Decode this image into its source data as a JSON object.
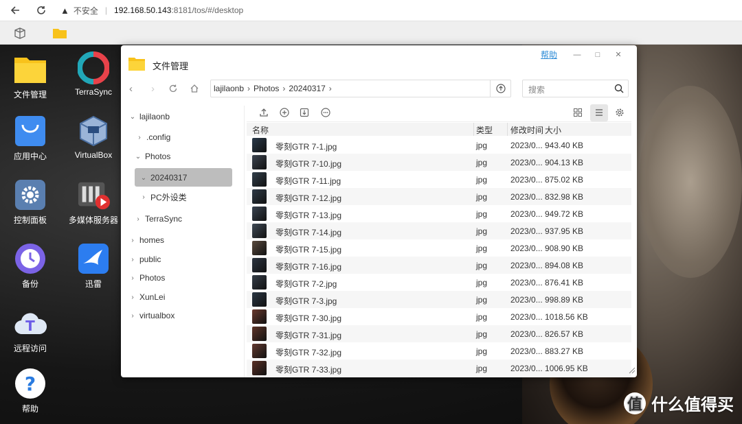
{
  "browser": {
    "insecure_label": "不安全",
    "url_host": "192.168.50.143",
    "url_rest": ":8181/tos/#/desktop"
  },
  "desktop_icons": [
    {
      "label": "文件管理",
      "icon": "folder-icon"
    },
    {
      "label": "TerraSync",
      "icon": "terrasync-icon"
    },
    {
      "label": "应用中心",
      "icon": "app-store-icon"
    },
    {
      "label": "VirtualBox",
      "icon": "virtualbox-icon"
    },
    {
      "label": "控制面板",
      "icon": "gear-icon"
    },
    {
      "label": "多媒体服务器",
      "icon": "media-server-icon"
    },
    {
      "label": "备份",
      "icon": "backup-clock-icon"
    },
    {
      "label": "迅雷",
      "icon": "xunlei-bird-icon"
    },
    {
      "label": "远程访问",
      "icon": "cloud-t-icon"
    },
    {
      "label": "帮助",
      "icon": "help-icon"
    }
  ],
  "watermark": {
    "text": "什么值得买",
    "logo": "值"
  },
  "file_manager": {
    "title": "文件管理",
    "help_label": "帮助",
    "breadcrumb": [
      "lajilaonb",
      "Photos",
      "20240317"
    ],
    "search_placeholder": "搜索",
    "sidebar": {
      "root": "lajilaonb",
      "config": ".config",
      "photos": "Photos",
      "selected": "20240317",
      "pc": "PC外设类",
      "terrasync": "TerraSync",
      "homes": "homes",
      "public": "public",
      "photos_root": "Photos",
      "xunlei": "XunLei",
      "virtualbox": "virtualbox"
    },
    "columns": {
      "name": "名称",
      "type": "类型",
      "modified": "修改时间",
      "size": "大小"
    },
    "files": [
      {
        "name": "零刻GTR 7-1.jpg",
        "type": "jpg",
        "modified": "2023/0...",
        "size": "943.40 KB",
        "thumb": "#2a3a4a"
      },
      {
        "name": "零刻GTR 7-10.jpg",
        "type": "jpg",
        "modified": "2023/0...",
        "size": "904.13 KB",
        "thumb": "#3c4450"
      },
      {
        "name": "零刻GTR 7-11.jpg",
        "type": "jpg",
        "modified": "2023/0...",
        "size": "875.02 KB",
        "thumb": "#33404c"
      },
      {
        "name": "零刻GTR 7-12.jpg",
        "type": "jpg",
        "modified": "2023/0...",
        "size": "832.98 KB",
        "thumb": "#2e3a46"
      },
      {
        "name": "零刻GTR 7-13.jpg",
        "type": "jpg",
        "modified": "2023/0...",
        "size": "949.72 KB",
        "thumb": "#394350"
      },
      {
        "name": "零刻GTR 7-14.jpg",
        "type": "jpg",
        "modified": "2023/0...",
        "size": "937.95 KB",
        "thumb": "#404a56"
      },
      {
        "name": "零刻GTR 7-15.jpg",
        "type": "jpg",
        "modified": "2023/0...",
        "size": "908.90 KB",
        "thumb": "#5a4a3e"
      },
      {
        "name": "零刻GTR 7-16.jpg",
        "type": "jpg",
        "modified": "2023/0...",
        "size": "894.08 KB",
        "thumb": "#2c3440"
      },
      {
        "name": "零刻GTR 7-2.jpg",
        "type": "jpg",
        "modified": "2023/0...",
        "size": "876.41 KB",
        "thumb": "#353d48"
      },
      {
        "name": "零刻GTR 7-3.jpg",
        "type": "jpg",
        "modified": "2023/0...",
        "size": "998.89 KB",
        "thumb": "#2b3744"
      },
      {
        "name": "零刻GTR 7-30.jpg",
        "type": "jpg",
        "modified": "2023/0...",
        "size": "1018.56 KB",
        "thumb": "#6a3a2e"
      },
      {
        "name": "零刻GTR 7-31.jpg",
        "type": "jpg",
        "modified": "2023/0...",
        "size": "826.57 KB",
        "thumb": "#5e3428"
      },
      {
        "name": "零刻GTR 7-32.jpg",
        "type": "jpg",
        "modified": "2023/0...",
        "size": "883.27 KB",
        "thumb": "#643a30"
      },
      {
        "name": "零刻GTR 7-33.jpg",
        "type": "jpg",
        "modified": "2023/0...",
        "size": "1006.95 KB",
        "thumb": "#5a3026"
      }
    ]
  }
}
